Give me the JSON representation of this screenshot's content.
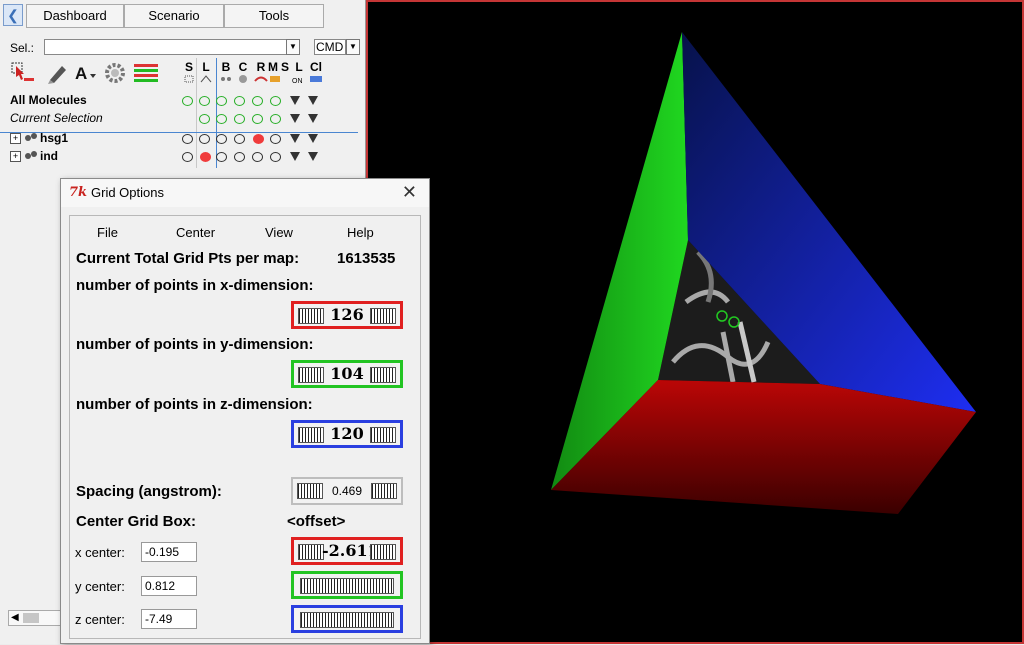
{
  "tabs": [
    "Dashboard",
    "Scenario",
    "Tools"
  ],
  "selection": {
    "label": "Sel.:",
    "value": "",
    "mode": "CMD"
  },
  "columns": [
    "S",
    "L",
    "B",
    "C",
    "R",
    "M",
    "S",
    "L",
    "Cl"
  ],
  "molecules": [
    {
      "name": "All Molecules",
      "style": "bold"
    },
    {
      "name": "Current Selection",
      "style": "italic"
    },
    {
      "name": "hsg1",
      "style": "bold"
    },
    {
      "name": "ind",
      "style": "bold"
    }
  ],
  "dialog": {
    "title": "Grid Options",
    "menu": [
      "File",
      "Center",
      "View",
      "Help"
    ],
    "total_label": "Current Total Grid Pts per map:",
    "total_value": "1613535",
    "x_dim_label": "number of points in x-dimension:",
    "x_dim_value": "126",
    "y_dim_label": "number of points in y-dimension:",
    "y_dim_value": "104",
    "z_dim_label": "number of points in z-dimension:",
    "z_dim_value": "120",
    "spacing_label": "Spacing (angstrom):",
    "spacing_value": "0.469",
    "center_label": "Center Grid Box:",
    "offset_label": "<offset>",
    "x_center_label": "x center:",
    "x_center_value": "-0.195",
    "x_offset_value": "-2.611",
    "y_center_label": "y center:",
    "y_center_value": "0.812",
    "z_center_label": "z center:",
    "z_center_value": "-7.49"
  },
  "colors": {
    "x": "#e02020",
    "y": "#22c422",
    "z": "#2a3fe0"
  }
}
